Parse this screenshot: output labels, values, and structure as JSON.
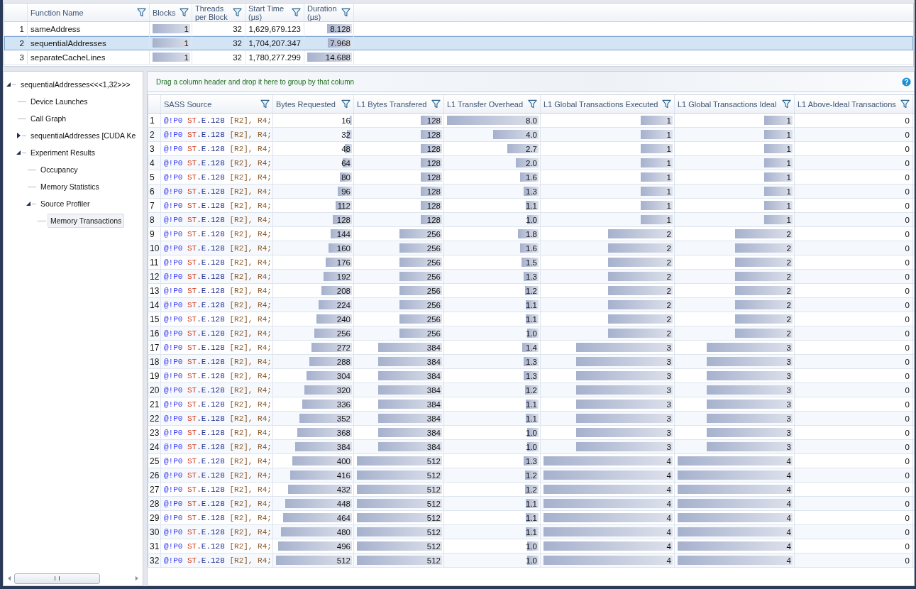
{
  "launches": {
    "columns": [
      {
        "label": "Function Name"
      },
      {
        "label": "Blocks"
      },
      {
        "label": "Threads per Block"
      },
      {
        "label": "Start Time (µs)"
      },
      {
        "label": "Duration (µs)"
      }
    ],
    "rows": [
      {
        "no": "1",
        "name": "sameAddress",
        "blocks": {
          "text": "1",
          "level": 1
        },
        "threads": "32",
        "start": "1,629,679.123",
        "duration": {
          "text": "8.128",
          "level": 0.553
        },
        "selected": false
      },
      {
        "no": "2",
        "name": "sequentialAddresses",
        "blocks": {
          "text": "1",
          "level": 1
        },
        "threads": "32",
        "start": "1,704,207.347",
        "duration": {
          "text": "7.968",
          "level": 0.542
        },
        "selected": true
      },
      {
        "no": "3",
        "name": "separateCacheLines",
        "blocks": {
          "text": "1",
          "level": 1
        },
        "threads": "32",
        "start": "1,780,277.299",
        "duration": {
          "text": "14.688",
          "level": 1
        },
        "selected": false
      }
    ]
  },
  "tree": [
    {
      "label": "sequentialAddresses<<<1,32>>>",
      "kind": "expanded",
      "selected": false,
      "children": [
        {
          "label": "Device Launches",
          "kind": "leaf",
          "selected": false
        },
        {
          "label": "Call Graph",
          "kind": "leaf",
          "selected": false
        },
        {
          "label": "sequentialAddresses [CUDA Ke",
          "kind": "collapsed",
          "selected": false
        },
        {
          "label": "Experiment Results",
          "kind": "expanded",
          "selected": false,
          "children": [
            {
              "label": "Occupancy",
              "kind": "leaf",
              "selected": false
            },
            {
              "label": "Memory Statistics",
              "kind": "leaf",
              "selected": false
            },
            {
              "label": "Source Profiler",
              "kind": "expanded",
              "selected": false,
              "children": [
                {
                  "label": "Memory Transactions",
                  "kind": "leaf",
                  "selected": true
                }
              ]
            }
          ]
        }
      ]
    }
  ],
  "group_hint": "Drag a column header and drop it here to group by that column",
  "grid": {
    "columns": [
      {
        "label": "SASS Source"
      },
      {
        "label": "Bytes Requested"
      },
      {
        "label": "L1 Bytes Transfered"
      },
      {
        "label": "L1 Transfer Overhead"
      },
      {
        "label": "L1 Global Transactions Executed"
      },
      {
        "label": "L1 Global Transactions Ideal"
      },
      {
        "label": "L1 Above-Ideal Transactions"
      }
    ],
    "rows": [
      {
        "no": "1",
        "source": [
          {
            "text": "@!P0 ",
            "kind": "predicate"
          },
          {
            "text": "ST",
            "kind": "opcode"
          },
          {
            "text": ".E.128 ",
            "kind": "modifier"
          },
          {
            "text": "[R2], ",
            "kind": "register"
          },
          {
            "text": "R4;",
            "kind": "register"
          }
        ],
        "cells": [
          {
            "text": "16",
            "level": 0.031
          },
          {
            "text": "128",
            "level": 0.25
          },
          {
            "text": "8.0",
            "level": 1
          },
          {
            "text": "1",
            "level": 0.25
          },
          {
            "text": "1",
            "level": 0.25
          },
          {
            "text": "0"
          }
        ]
      },
      {
        "no": "2",
        "source": [
          {
            "text": "@!P0 ",
            "kind": "predicate"
          },
          {
            "text": "ST",
            "kind": "opcode"
          },
          {
            "text": ".E.128 ",
            "kind": "modifier"
          },
          {
            "text": "[R2], ",
            "kind": "register"
          },
          {
            "text": "R4;",
            "kind": "register"
          }
        ],
        "cells": [
          {
            "text": "32",
            "level": 0.063
          },
          {
            "text": "128",
            "level": 0.25
          },
          {
            "text": "4.0",
            "level": 0.5
          },
          {
            "text": "1",
            "level": 0.25
          },
          {
            "text": "1",
            "level": 0.25
          },
          {
            "text": "0"
          }
        ]
      },
      {
        "no": "3",
        "source": [
          {
            "text": "@!P0 ",
            "kind": "predicate"
          },
          {
            "text": "ST",
            "kind": "opcode"
          },
          {
            "text": ".E.128 ",
            "kind": "modifier"
          },
          {
            "text": "[R2], ",
            "kind": "register"
          },
          {
            "text": "R4;",
            "kind": "register"
          }
        ],
        "cells": [
          {
            "text": "48",
            "level": 0.094
          },
          {
            "text": "128",
            "level": 0.25
          },
          {
            "text": "2.7",
            "level": 0.338
          },
          {
            "text": "1",
            "level": 0.25
          },
          {
            "text": "1",
            "level": 0.25
          },
          {
            "text": "0"
          }
        ]
      },
      {
        "no": "4",
        "source": [
          {
            "text": "@!P0 ",
            "kind": "predicate"
          },
          {
            "text": "ST",
            "kind": "opcode"
          },
          {
            "text": ".E.128 ",
            "kind": "modifier"
          },
          {
            "text": "[R2], ",
            "kind": "register"
          },
          {
            "text": "R4;",
            "kind": "register"
          }
        ],
        "cells": [
          {
            "text": "64",
            "level": 0.125
          },
          {
            "text": "128",
            "level": 0.25
          },
          {
            "text": "2.0",
            "level": 0.25
          },
          {
            "text": "1",
            "level": 0.25
          },
          {
            "text": "1",
            "level": 0.25
          },
          {
            "text": "0"
          }
        ]
      },
      {
        "no": "5",
        "source": [
          {
            "text": "@!P0 ",
            "kind": "predicate"
          },
          {
            "text": "ST",
            "kind": "opcode"
          },
          {
            "text": ".E.128 ",
            "kind": "modifier"
          },
          {
            "text": "[R2], ",
            "kind": "register"
          },
          {
            "text": "R4;",
            "kind": "register"
          }
        ],
        "cells": [
          {
            "text": "80",
            "level": 0.156
          },
          {
            "text": "128",
            "level": 0.25
          },
          {
            "text": "1.6",
            "level": 0.2
          },
          {
            "text": "1",
            "level": 0.25
          },
          {
            "text": "1",
            "level": 0.25
          },
          {
            "text": "0"
          }
        ]
      },
      {
        "no": "6",
        "source": [
          {
            "text": "@!P0 ",
            "kind": "predicate"
          },
          {
            "text": "ST",
            "kind": "opcode"
          },
          {
            "text": ".E.128 ",
            "kind": "modifier"
          },
          {
            "text": "[R2], ",
            "kind": "register"
          },
          {
            "text": "R4;",
            "kind": "register"
          }
        ],
        "cells": [
          {
            "text": "96",
            "level": 0.188
          },
          {
            "text": "128",
            "level": 0.25
          },
          {
            "text": "1.3",
            "level": 0.163
          },
          {
            "text": "1",
            "level": 0.25
          },
          {
            "text": "1",
            "level": 0.25
          },
          {
            "text": "0"
          }
        ]
      },
      {
        "no": "7",
        "source": [
          {
            "text": "@!P0 ",
            "kind": "predicate"
          },
          {
            "text": "ST",
            "kind": "opcode"
          },
          {
            "text": ".E.128 ",
            "kind": "modifier"
          },
          {
            "text": "[R2], ",
            "kind": "register"
          },
          {
            "text": "R4;",
            "kind": "register"
          }
        ],
        "cells": [
          {
            "text": "112",
            "level": 0.219
          },
          {
            "text": "128",
            "level": 0.25
          },
          {
            "text": "1.1",
            "level": 0.138
          },
          {
            "text": "1",
            "level": 0.25
          },
          {
            "text": "1",
            "level": 0.25
          },
          {
            "text": "0"
          }
        ]
      },
      {
        "no": "8",
        "source": [
          {
            "text": "@!P0 ",
            "kind": "predicate"
          },
          {
            "text": "ST",
            "kind": "opcode"
          },
          {
            "text": ".E.128 ",
            "kind": "modifier"
          },
          {
            "text": "[R2], ",
            "kind": "register"
          },
          {
            "text": "R4;",
            "kind": "register"
          }
        ],
        "cells": [
          {
            "text": "128",
            "level": 0.25
          },
          {
            "text": "128",
            "level": 0.25
          },
          {
            "text": "1.0",
            "level": 0.125
          },
          {
            "text": "1",
            "level": 0.25
          },
          {
            "text": "1",
            "level": 0.25
          },
          {
            "text": "0"
          }
        ]
      },
      {
        "no": "9",
        "source": [
          {
            "text": "@!P0 ",
            "kind": "predicate"
          },
          {
            "text": "ST",
            "kind": "opcode"
          },
          {
            "text": ".E.128 ",
            "kind": "modifier"
          },
          {
            "text": "[R2], ",
            "kind": "register"
          },
          {
            "text": "R4;",
            "kind": "register"
          }
        ],
        "cells": [
          {
            "text": "144",
            "level": 0.281
          },
          {
            "text": "256",
            "level": 0.5
          },
          {
            "text": "1.8",
            "level": 0.225
          },
          {
            "text": "2",
            "level": 0.5
          },
          {
            "text": "2",
            "level": 0.5
          },
          {
            "text": "0"
          }
        ]
      },
      {
        "no": "10",
        "source": [
          {
            "text": "@!P0 ",
            "kind": "predicate"
          },
          {
            "text": "ST",
            "kind": "opcode"
          },
          {
            "text": ".E.128 ",
            "kind": "modifier"
          },
          {
            "text": "[R2], ",
            "kind": "register"
          },
          {
            "text": "R4;",
            "kind": "register"
          }
        ],
        "cells": [
          {
            "text": "160",
            "level": 0.313
          },
          {
            "text": "256",
            "level": 0.5
          },
          {
            "text": "1.6",
            "level": 0.2
          },
          {
            "text": "2",
            "level": 0.5
          },
          {
            "text": "2",
            "level": 0.5
          },
          {
            "text": "0"
          }
        ]
      },
      {
        "no": "11",
        "source": [
          {
            "text": "@!P0 ",
            "kind": "predicate"
          },
          {
            "text": "ST",
            "kind": "opcode"
          },
          {
            "text": ".E.128 ",
            "kind": "modifier"
          },
          {
            "text": "[R2], ",
            "kind": "register"
          },
          {
            "text": "R4;",
            "kind": "register"
          }
        ],
        "cells": [
          {
            "text": "176",
            "level": 0.344
          },
          {
            "text": "256",
            "level": 0.5
          },
          {
            "text": "1.5",
            "level": 0.188
          },
          {
            "text": "2",
            "level": 0.5
          },
          {
            "text": "2",
            "level": 0.5
          },
          {
            "text": "0"
          }
        ]
      },
      {
        "no": "12",
        "source": [
          {
            "text": "@!P0 ",
            "kind": "predicate"
          },
          {
            "text": "ST",
            "kind": "opcode"
          },
          {
            "text": ".E.128 ",
            "kind": "modifier"
          },
          {
            "text": "[R2], ",
            "kind": "register"
          },
          {
            "text": "R4;",
            "kind": "register"
          }
        ],
        "cells": [
          {
            "text": "192",
            "level": 0.375
          },
          {
            "text": "256",
            "level": 0.5
          },
          {
            "text": "1.3",
            "level": 0.163
          },
          {
            "text": "2",
            "level": 0.5
          },
          {
            "text": "2",
            "level": 0.5
          },
          {
            "text": "0"
          }
        ]
      },
      {
        "no": "13",
        "source": [
          {
            "text": "@!P0 ",
            "kind": "predicate"
          },
          {
            "text": "ST",
            "kind": "opcode"
          },
          {
            "text": ".E.128 ",
            "kind": "modifier"
          },
          {
            "text": "[R2], ",
            "kind": "register"
          },
          {
            "text": "R4;",
            "kind": "register"
          }
        ],
        "cells": [
          {
            "text": "208",
            "level": 0.406
          },
          {
            "text": "256",
            "level": 0.5
          },
          {
            "text": "1.2",
            "level": 0.15
          },
          {
            "text": "2",
            "level": 0.5
          },
          {
            "text": "2",
            "level": 0.5
          },
          {
            "text": "0"
          }
        ]
      },
      {
        "no": "14",
        "source": [
          {
            "text": "@!P0 ",
            "kind": "predicate"
          },
          {
            "text": "ST",
            "kind": "opcode"
          },
          {
            "text": ".E.128 ",
            "kind": "modifier"
          },
          {
            "text": "[R2], ",
            "kind": "register"
          },
          {
            "text": "R4;",
            "kind": "register"
          }
        ],
        "cells": [
          {
            "text": "224",
            "level": 0.438
          },
          {
            "text": "256",
            "level": 0.5
          },
          {
            "text": "1.1",
            "level": 0.138
          },
          {
            "text": "2",
            "level": 0.5
          },
          {
            "text": "2",
            "level": 0.5
          },
          {
            "text": "0"
          }
        ]
      },
      {
        "no": "15",
        "source": [
          {
            "text": "@!P0 ",
            "kind": "predicate"
          },
          {
            "text": "ST",
            "kind": "opcode"
          },
          {
            "text": ".E.128 ",
            "kind": "modifier"
          },
          {
            "text": "[R2], ",
            "kind": "register"
          },
          {
            "text": "R4;",
            "kind": "register"
          }
        ],
        "cells": [
          {
            "text": "240",
            "level": 0.469
          },
          {
            "text": "256",
            "level": 0.5
          },
          {
            "text": "1.1",
            "level": 0.138
          },
          {
            "text": "2",
            "level": 0.5
          },
          {
            "text": "2",
            "level": 0.5
          },
          {
            "text": "0"
          }
        ]
      },
      {
        "no": "16",
        "source": [
          {
            "text": "@!P0 ",
            "kind": "predicate"
          },
          {
            "text": "ST",
            "kind": "opcode"
          },
          {
            "text": ".E.128 ",
            "kind": "modifier"
          },
          {
            "text": "[R2], ",
            "kind": "register"
          },
          {
            "text": "R4;",
            "kind": "register"
          }
        ],
        "cells": [
          {
            "text": "256",
            "level": 0.5
          },
          {
            "text": "256",
            "level": 0.5
          },
          {
            "text": "1.0",
            "level": 0.125
          },
          {
            "text": "2",
            "level": 0.5
          },
          {
            "text": "2",
            "level": 0.5
          },
          {
            "text": "0"
          }
        ]
      },
      {
        "no": "17",
        "source": [
          {
            "text": "@!P0 ",
            "kind": "predicate"
          },
          {
            "text": "ST",
            "kind": "opcode"
          },
          {
            "text": ".E.128 ",
            "kind": "modifier"
          },
          {
            "text": "[R2], ",
            "kind": "register"
          },
          {
            "text": "R4;",
            "kind": "register"
          }
        ],
        "cells": [
          {
            "text": "272",
            "level": 0.531
          },
          {
            "text": "384",
            "level": 0.75
          },
          {
            "text": "1.4",
            "level": 0.175
          },
          {
            "text": "3",
            "level": 0.75
          },
          {
            "text": "3",
            "level": 0.75
          },
          {
            "text": "0"
          }
        ]
      },
      {
        "no": "18",
        "source": [
          {
            "text": "@!P0 ",
            "kind": "predicate"
          },
          {
            "text": "ST",
            "kind": "opcode"
          },
          {
            "text": ".E.128 ",
            "kind": "modifier"
          },
          {
            "text": "[R2], ",
            "kind": "register"
          },
          {
            "text": "R4;",
            "kind": "register"
          }
        ],
        "cells": [
          {
            "text": "288",
            "level": 0.563
          },
          {
            "text": "384",
            "level": 0.75
          },
          {
            "text": "1.3",
            "level": 0.163
          },
          {
            "text": "3",
            "level": 0.75
          },
          {
            "text": "3",
            "level": 0.75
          },
          {
            "text": "0"
          }
        ]
      },
      {
        "no": "19",
        "source": [
          {
            "text": "@!P0 ",
            "kind": "predicate"
          },
          {
            "text": "ST",
            "kind": "opcode"
          },
          {
            "text": ".E.128 ",
            "kind": "modifier"
          },
          {
            "text": "[R2], ",
            "kind": "register"
          },
          {
            "text": "R4;",
            "kind": "register"
          }
        ],
        "cells": [
          {
            "text": "304",
            "level": 0.594
          },
          {
            "text": "384",
            "level": 0.75
          },
          {
            "text": "1.3",
            "level": 0.163
          },
          {
            "text": "3",
            "level": 0.75
          },
          {
            "text": "3",
            "level": 0.75
          },
          {
            "text": "0"
          }
        ]
      },
      {
        "no": "20",
        "source": [
          {
            "text": "@!P0 ",
            "kind": "predicate"
          },
          {
            "text": "ST",
            "kind": "opcode"
          },
          {
            "text": ".E.128 ",
            "kind": "modifier"
          },
          {
            "text": "[R2], ",
            "kind": "register"
          },
          {
            "text": "R4;",
            "kind": "register"
          }
        ],
        "cells": [
          {
            "text": "320",
            "level": 0.625
          },
          {
            "text": "384",
            "level": 0.75
          },
          {
            "text": "1.2",
            "level": 0.15
          },
          {
            "text": "3",
            "level": 0.75
          },
          {
            "text": "3",
            "level": 0.75
          },
          {
            "text": "0"
          }
        ]
      },
      {
        "no": "21",
        "source": [
          {
            "text": "@!P0 ",
            "kind": "predicate"
          },
          {
            "text": "ST",
            "kind": "opcode"
          },
          {
            "text": ".E.128 ",
            "kind": "modifier"
          },
          {
            "text": "[R2], ",
            "kind": "register"
          },
          {
            "text": "R4;",
            "kind": "register"
          }
        ],
        "cells": [
          {
            "text": "336",
            "level": 0.656
          },
          {
            "text": "384",
            "level": 0.75
          },
          {
            "text": "1.1",
            "level": 0.138
          },
          {
            "text": "3",
            "level": 0.75
          },
          {
            "text": "3",
            "level": 0.75
          },
          {
            "text": "0"
          }
        ]
      },
      {
        "no": "22",
        "source": [
          {
            "text": "@!P0 ",
            "kind": "predicate"
          },
          {
            "text": "ST",
            "kind": "opcode"
          },
          {
            "text": ".E.128 ",
            "kind": "modifier"
          },
          {
            "text": "[R2], ",
            "kind": "register"
          },
          {
            "text": "R4;",
            "kind": "register"
          }
        ],
        "cells": [
          {
            "text": "352",
            "level": 0.688
          },
          {
            "text": "384",
            "level": 0.75
          },
          {
            "text": "1.1",
            "level": 0.138
          },
          {
            "text": "3",
            "level": 0.75
          },
          {
            "text": "3",
            "level": 0.75
          },
          {
            "text": "0"
          }
        ]
      },
      {
        "no": "23",
        "source": [
          {
            "text": "@!P0 ",
            "kind": "predicate"
          },
          {
            "text": "ST",
            "kind": "opcode"
          },
          {
            "text": ".E.128 ",
            "kind": "modifier"
          },
          {
            "text": "[R2], ",
            "kind": "register"
          },
          {
            "text": "R4;",
            "kind": "register"
          }
        ],
        "cells": [
          {
            "text": "368",
            "level": 0.719
          },
          {
            "text": "384",
            "level": 0.75
          },
          {
            "text": "1.0",
            "level": 0.125
          },
          {
            "text": "3",
            "level": 0.75
          },
          {
            "text": "3",
            "level": 0.75
          },
          {
            "text": "0"
          }
        ]
      },
      {
        "no": "24",
        "source": [
          {
            "text": "@!P0 ",
            "kind": "predicate"
          },
          {
            "text": "ST",
            "kind": "opcode"
          },
          {
            "text": ".E.128 ",
            "kind": "modifier"
          },
          {
            "text": "[R2], ",
            "kind": "register"
          },
          {
            "text": "R4;",
            "kind": "register"
          }
        ],
        "cells": [
          {
            "text": "384",
            "level": 0.75
          },
          {
            "text": "384",
            "level": 0.75
          },
          {
            "text": "1.0",
            "level": 0.125
          },
          {
            "text": "3",
            "level": 0.75
          },
          {
            "text": "3",
            "level": 0.75
          },
          {
            "text": "0"
          }
        ]
      },
      {
        "no": "25",
        "source": [
          {
            "text": "@!P0 ",
            "kind": "predicate"
          },
          {
            "text": "ST",
            "kind": "opcode"
          },
          {
            "text": ".E.128 ",
            "kind": "modifier"
          },
          {
            "text": "[R2], ",
            "kind": "register"
          },
          {
            "text": "R4;",
            "kind": "register"
          }
        ],
        "cells": [
          {
            "text": "400",
            "level": 0.781
          },
          {
            "text": "512",
            "level": 1
          },
          {
            "text": "1.3",
            "level": 0.163
          },
          {
            "text": "4",
            "level": 1
          },
          {
            "text": "4",
            "level": 1
          },
          {
            "text": "0"
          }
        ]
      },
      {
        "no": "26",
        "source": [
          {
            "text": "@!P0 ",
            "kind": "predicate"
          },
          {
            "text": "ST",
            "kind": "opcode"
          },
          {
            "text": ".E.128 ",
            "kind": "modifier"
          },
          {
            "text": "[R2], ",
            "kind": "register"
          },
          {
            "text": "R4;",
            "kind": "register"
          }
        ],
        "cells": [
          {
            "text": "416",
            "level": 0.813
          },
          {
            "text": "512",
            "level": 1
          },
          {
            "text": "1.2",
            "level": 0.15
          },
          {
            "text": "4",
            "level": 1
          },
          {
            "text": "4",
            "level": 1
          },
          {
            "text": "0"
          }
        ]
      },
      {
        "no": "27",
        "source": [
          {
            "text": "@!P0 ",
            "kind": "predicate"
          },
          {
            "text": "ST",
            "kind": "opcode"
          },
          {
            "text": ".E.128 ",
            "kind": "modifier"
          },
          {
            "text": "[R2], ",
            "kind": "register"
          },
          {
            "text": "R4;",
            "kind": "register"
          }
        ],
        "cells": [
          {
            "text": "432",
            "level": 0.844
          },
          {
            "text": "512",
            "level": 1
          },
          {
            "text": "1.2",
            "level": 0.15
          },
          {
            "text": "4",
            "level": 1
          },
          {
            "text": "4",
            "level": 1
          },
          {
            "text": "0"
          }
        ]
      },
      {
        "no": "28",
        "source": [
          {
            "text": "@!P0 ",
            "kind": "predicate"
          },
          {
            "text": "ST",
            "kind": "opcode"
          },
          {
            "text": ".E.128 ",
            "kind": "modifier"
          },
          {
            "text": "[R2], ",
            "kind": "register"
          },
          {
            "text": "R4;",
            "kind": "register"
          }
        ],
        "cells": [
          {
            "text": "448",
            "level": 0.875
          },
          {
            "text": "512",
            "level": 1
          },
          {
            "text": "1.1",
            "level": 0.138
          },
          {
            "text": "4",
            "level": 1
          },
          {
            "text": "4",
            "level": 1
          },
          {
            "text": "0"
          }
        ]
      },
      {
        "no": "29",
        "source": [
          {
            "text": "@!P0 ",
            "kind": "predicate"
          },
          {
            "text": "ST",
            "kind": "opcode"
          },
          {
            "text": ".E.128 ",
            "kind": "modifier"
          },
          {
            "text": "[R2], ",
            "kind": "register"
          },
          {
            "text": "R4;",
            "kind": "register"
          }
        ],
        "cells": [
          {
            "text": "464",
            "level": 0.906
          },
          {
            "text": "512",
            "level": 1
          },
          {
            "text": "1.1",
            "level": 0.138
          },
          {
            "text": "4",
            "level": 1
          },
          {
            "text": "4",
            "level": 1
          },
          {
            "text": "0"
          }
        ]
      },
      {
        "no": "30",
        "source": [
          {
            "text": "@!P0 ",
            "kind": "predicate"
          },
          {
            "text": "ST",
            "kind": "opcode"
          },
          {
            "text": ".E.128 ",
            "kind": "modifier"
          },
          {
            "text": "[R2], ",
            "kind": "register"
          },
          {
            "text": "R4;",
            "kind": "register"
          }
        ],
        "cells": [
          {
            "text": "480",
            "level": 0.938
          },
          {
            "text": "512",
            "level": 1
          },
          {
            "text": "1.1",
            "level": 0.138
          },
          {
            "text": "4",
            "level": 1
          },
          {
            "text": "4",
            "level": 1
          },
          {
            "text": "0"
          }
        ]
      },
      {
        "no": "31",
        "source": [
          {
            "text": "@!P0 ",
            "kind": "predicate"
          },
          {
            "text": "ST",
            "kind": "opcode"
          },
          {
            "text": ".E.128 ",
            "kind": "modifier"
          },
          {
            "text": "[R2], ",
            "kind": "register"
          },
          {
            "text": "R4;",
            "kind": "register"
          }
        ],
        "cells": [
          {
            "text": "496",
            "level": 0.969
          },
          {
            "text": "512",
            "level": 1
          },
          {
            "text": "1.0",
            "level": 0.125
          },
          {
            "text": "4",
            "level": 1
          },
          {
            "text": "4",
            "level": 1
          },
          {
            "text": "0"
          }
        ]
      },
      {
        "no": "32",
        "source": [
          {
            "text": "@!P0 ",
            "kind": "predicate"
          },
          {
            "text": "ST",
            "kind": "opcode"
          },
          {
            "text": ".E.128 ",
            "kind": "modifier"
          },
          {
            "text": "[R2], ",
            "kind": "register"
          },
          {
            "text": "R4;",
            "kind": "register"
          }
        ],
        "cells": [
          {
            "text": "512",
            "level": 1
          },
          {
            "text": "512",
            "level": 1
          },
          {
            "text": "1.0",
            "level": 0.125
          },
          {
            "text": "4",
            "level": 1
          },
          {
            "text": "4",
            "level": 1
          },
          {
            "text": "0"
          }
        ]
      }
    ]
  }
}
